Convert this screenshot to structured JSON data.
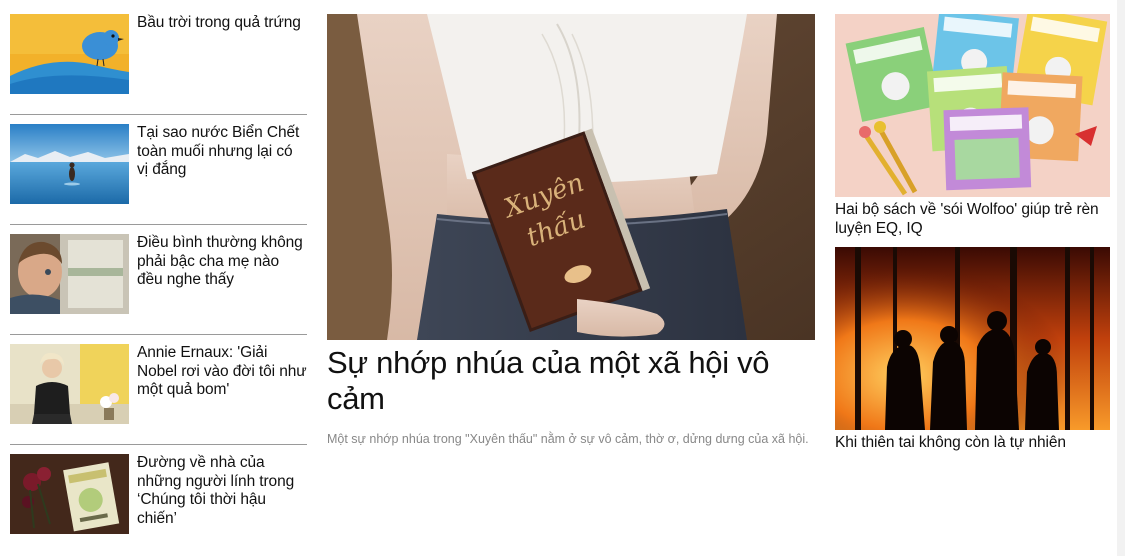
{
  "left_list": [
    {
      "title": "Bầu trời trong quả trứng",
      "image": "blue-bird-illustration"
    },
    {
      "title": "Tại sao nước Biển Chết toàn muối nhưng lại có vị đắng",
      "image": "dead-sea-photo"
    },
    {
      "title": "Điều bình thường không phải bậc cha mẹ nào đều nghe thấy",
      "image": "child-at-window-photo"
    },
    {
      "title": "Annie Ernaux: 'Giải Nobel rơi vào đời tôi như một quả bom'",
      "image": "annie-ernaux-photo"
    },
    {
      "title": "Đường về nhà của những người lính trong ‘Chúng tôi thời hậu chiến’",
      "image": "book-with-flowers-photo"
    }
  ],
  "feature": {
    "title": "Sự nhớp nhúa của một xã hội vô cảm",
    "sapo": "Một sự nhớp nhúa trong \"Xuyên thấu\" nằm ở sự vô cảm, thờ ơ, dửng dưng của xã hội.",
    "image": "girl-holding-book-photo"
  },
  "right_list": [
    {
      "title": "Hai bộ sách về 'sói Wolfoo' giúp trẻ rèn luyện EQ, IQ",
      "image": "wolfoo-books-photo"
    },
    {
      "title": "Khi thiên tai không còn là tự nhiên",
      "image": "wildfire-firefighters-photo"
    }
  ]
}
